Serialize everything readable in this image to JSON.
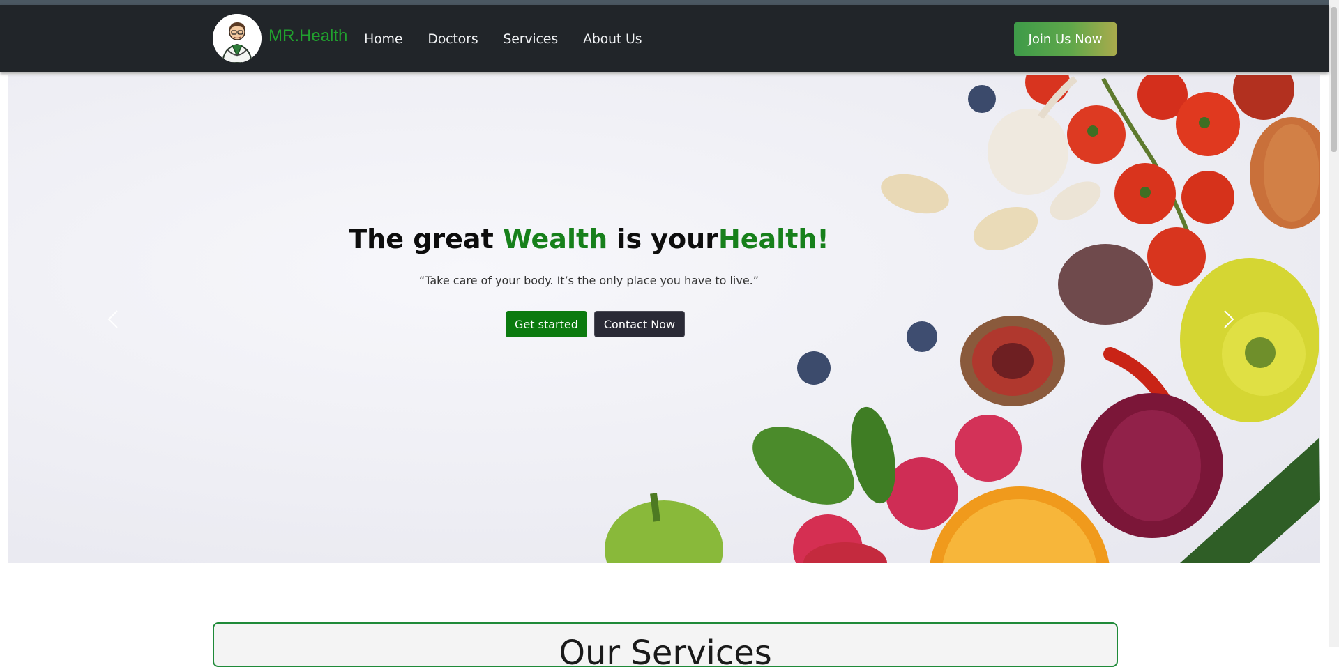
{
  "brand": {
    "name": "MR.Health",
    "logo_icon": "doctor-avatar-icon"
  },
  "nav": {
    "links": [
      "Home",
      "Doctors",
      "Services",
      "About Us"
    ],
    "cta": "Join Us Now"
  },
  "hero": {
    "headline_part1": "The great ",
    "headline_part2": "Wealth",
    "headline_part3": " is your",
    "headline_part4": "Health!",
    "quote": "“Take care of your body. It’s the only place you have to live.”",
    "primary_button": "Get started",
    "secondary_button": "Contact Now",
    "prev_icon": "chevron-left-icon",
    "next_icon": "chevron-right-icon"
  },
  "services": {
    "title": "Our Services"
  },
  "colors": {
    "navbar": "#212529",
    "brand_green": "#21a12e",
    "headline_green": "#17801b",
    "primary_button": "#0b7a0f",
    "secondary_button": "#2a2a36",
    "services_border": "#1f8a39"
  }
}
